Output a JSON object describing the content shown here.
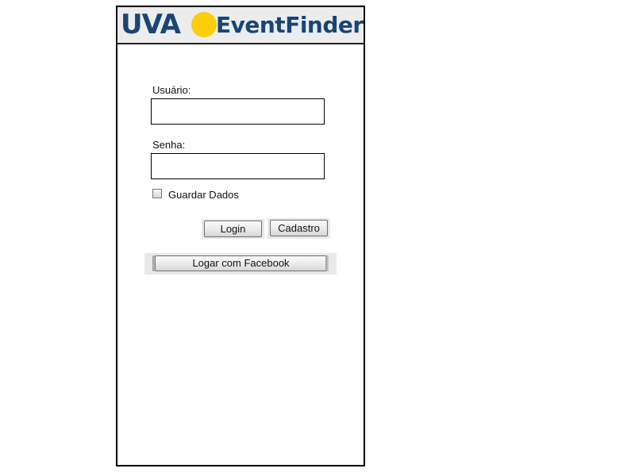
{
  "header": {
    "logo_uva": "UVA",
    "logo_eventfinder": "EventFinder",
    "uva_color": "#17457a",
    "sun_color": "#fecd0a",
    "eventfinder_color": "#17457a"
  },
  "form": {
    "username_label": "Usuário:",
    "username_value": "",
    "password_label": "Senha:",
    "password_value": "",
    "remember_label": "Guardar Dados",
    "remember_checked": false
  },
  "buttons": {
    "login_label": "Login",
    "register_label": "Cadastro",
    "facebook_label": "Logar com Facebook"
  }
}
